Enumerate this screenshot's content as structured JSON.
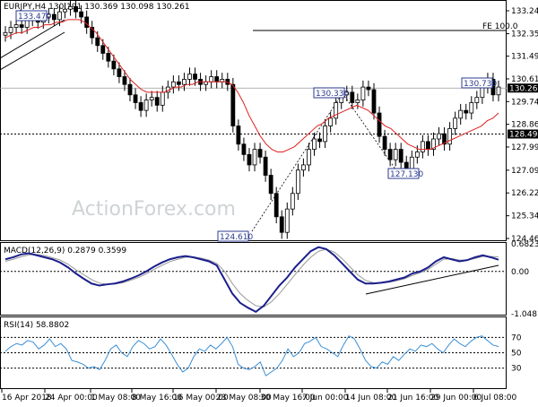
{
  "chart_data": [
    {
      "type": "candlestick",
      "header": "EURJPY,H4  130.191 130.369 130.098 130.261",
      "y_ticks": [
        "133.240",
        "132.355",
        "131.490",
        "130.615",
        "129.740",
        "128.865",
        "127.990",
        "127.095",
        "126.220",
        "125.340",
        "124.465"
      ],
      "ylim": [
        124.465,
        133.24
      ],
      "x_ticks": [
        "16 Apr 2018",
        "24 Apr 00:00",
        "1 May 08:00",
        "8 May 16:00",
        "16 May 00:00",
        "23 May 08:00",
        "30 May 16:00",
        "7 Jun 00:00",
        "14 Jun 08:00",
        "21 Jun 16:00",
        "29 Jun 00:00",
        "6 Jul 08:00"
      ],
      "current_price": "130.261",
      "level_label": "128.490",
      "fe_label": "FE 100.0",
      "annotations": [
        {
          "text": "133.470"
        },
        {
          "text": "124.610"
        },
        {
          "text": "130.330"
        },
        {
          "text": "127.130"
        },
        {
          "text": "130.730"
        }
      ],
      "close": [
        132.4,
        132.6,
        132.7,
        132.6,
        132.9,
        133.0,
        132.8,
        133.0,
        133.1,
        132.9,
        133.2,
        133.3,
        133.4,
        133.2,
        133.0,
        132.6,
        132.2,
        131.9,
        131.6,
        131.3,
        131.0,
        130.7,
        130.4,
        130.0,
        129.7,
        129.4,
        129.8,
        129.9,
        129.6,
        130.1,
        130.3,
        130.5,
        130.4,
        130.6,
        130.8,
        130.6,
        130.4,
        130.5,
        130.7,
        130.5,
        130.6,
        130.4,
        128.8,
        128.1,
        127.7,
        127.3,
        127.9,
        127.6,
        126.9,
        126.2,
        125.3,
        124.7,
        125.6,
        126.2,
        127.1,
        127.3,
        127.9,
        128.3,
        128.2,
        128.8,
        129.1,
        129.7,
        130.0,
        130.1,
        129.7,
        129.8,
        130.3,
        130.2,
        129.3,
        128.4,
        127.9,
        127.5,
        127.9,
        127.4,
        127.1,
        127.6,
        127.8,
        128.2,
        127.9,
        128.3,
        128.5,
        128.1,
        128.7,
        129.1,
        129.4,
        129.3,
        129.7,
        129.9,
        130.3,
        130.6,
        130.0,
        130.3
      ],
      "ma": [
        132.2,
        132.3,
        132.4,
        132.4,
        132.5,
        132.6,
        132.6,
        132.7,
        132.7,
        132.8,
        132.8,
        132.9,
        132.9,
        132.9,
        132.8,
        132.6,
        132.4,
        132.1,
        131.8,
        131.5,
        131.2,
        130.9,
        130.6,
        130.4,
        130.2,
        130.1,
        130.1,
        130.1,
        130.1,
        130.2,
        130.3,
        130.3,
        130.4,
        130.4,
        130.5,
        130.5,
        130.5,
        130.5,
        130.5,
        130.5,
        130.4,
        130.1,
        129.7,
        129.2,
        128.8,
        128.4,
        128.1,
        127.9,
        127.8,
        127.8,
        127.9,
        128.0,
        128.2,
        128.4,
        128.6,
        128.8,
        128.9,
        129.1,
        129.2,
        129.3,
        129.4,
        129.5,
        129.6,
        129.5,
        129.4,
        129.2,
        129.0,
        128.8,
        128.7,
        128.5,
        128.3,
        128.1,
        128.0,
        127.9,
        127.9,
        127.9,
        128.0,
        128.1,
        128.2,
        128.3,
        128.4,
        128.5,
        128.6,
        128.7,
        128.8,
        129.0,
        129.1,
        129.3
      ]
    },
    {
      "type": "line",
      "header": "MACD(12,26,9) 0.2879 0.3599",
      "y_ticks": [
        "0.6823",
        "0.00",
        "-1.0481"
      ],
      "ylim": [
        -1.0481,
        0.6823
      ],
      "macd": [
        0.3,
        0.35,
        0.42,
        0.45,
        0.4,
        0.35,
        0.3,
        0.22,
        0.1,
        -0.05,
        -0.18,
        -0.3,
        -0.35,
        -0.32,
        -0.3,
        -0.25,
        -0.18,
        -0.1,
        0.0,
        0.12,
        0.22,
        0.3,
        0.35,
        0.38,
        0.35,
        0.3,
        0.25,
        0.15,
        -0.2,
        -0.55,
        -0.78,
        -0.9,
        -1.0,
        -0.85,
        -0.6,
        -0.35,
        -0.15,
        0.1,
        0.3,
        0.5,
        0.6,
        0.55,
        0.4,
        0.2,
        0.0,
        -0.2,
        -0.3,
        -0.3,
        -0.28,
        -0.25,
        -0.2,
        -0.15,
        -0.05,
        0.0,
        0.1,
        0.25,
        0.35,
        0.3,
        0.25,
        0.28,
        0.35,
        0.4,
        0.35,
        0.29
      ],
      "signal": [
        0.25,
        0.3,
        0.36,
        0.41,
        0.42,
        0.39,
        0.34,
        0.28,
        0.18,
        0.04,
        -0.08,
        -0.2,
        -0.29,
        -0.32,
        -0.31,
        -0.28,
        -0.22,
        -0.15,
        -0.06,
        0.05,
        0.15,
        0.24,
        0.3,
        0.35,
        0.36,
        0.33,
        0.28,
        0.2,
        0.0,
        -0.3,
        -0.55,
        -0.72,
        -0.85,
        -0.88,
        -0.75,
        -0.55,
        -0.32,
        -0.08,
        0.15,
        0.35,
        0.5,
        0.55,
        0.48,
        0.32,
        0.12,
        -0.08,
        -0.22,
        -0.28,
        -0.29,
        -0.27,
        -0.23,
        -0.18,
        -0.1,
        -0.03,
        0.05,
        0.18,
        0.3,
        0.32,
        0.28,
        0.28,
        0.32,
        0.37,
        0.37,
        0.36
      ]
    },
    {
      "type": "line",
      "header": "RSI(14) 58.8802",
      "y_ticks": [
        "70",
        "50",
        "30"
      ],
      "ylim": [
        5,
        95
      ],
      "rsi": [
        52,
        58,
        62,
        60,
        66,
        64,
        55,
        60,
        68,
        58,
        62,
        55,
        40,
        38,
        35,
        30,
        32,
        28,
        40,
        55,
        60,
        50,
        45,
        58,
        66,
        62,
        55,
        58,
        68,
        60,
        48,
        35,
        25,
        30,
        45,
        55,
        52,
        60,
        55,
        62,
        70,
        58,
        35,
        30,
        28,
        32,
        38,
        20,
        25,
        30,
        40,
        55,
        45,
        50,
        62,
        65,
        70,
        58,
        55,
        50,
        45,
        60,
        72,
        68,
        55,
        40,
        32,
        30,
        38,
        35,
        45,
        40,
        48,
        55,
        52,
        60,
        58,
        62,
        55,
        50,
        60,
        68,
        62,
        58,
        65,
        70,
        72,
        66,
        60,
        58
      ]
    }
  ],
  "watermark": "ActionForex.com"
}
